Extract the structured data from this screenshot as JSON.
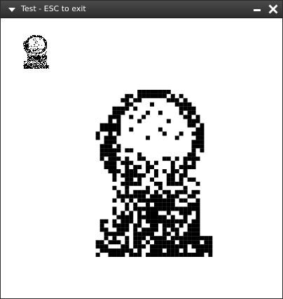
{
  "window": {
    "title": "Test - ESC to exit",
    "icons": {
      "menu": "chevron-down-icon",
      "minimize": "minimize-icon",
      "close": "close-icon"
    },
    "colors": {
      "titlebar": "#3a3a3a",
      "title_text": "#ffffff",
      "background": "#ffffff",
      "pixels": "#000000"
    }
  },
  "content": {
    "thumbnail_image": "portrait-thumbnail",
    "large_image": "portrait-pixelated"
  }
}
